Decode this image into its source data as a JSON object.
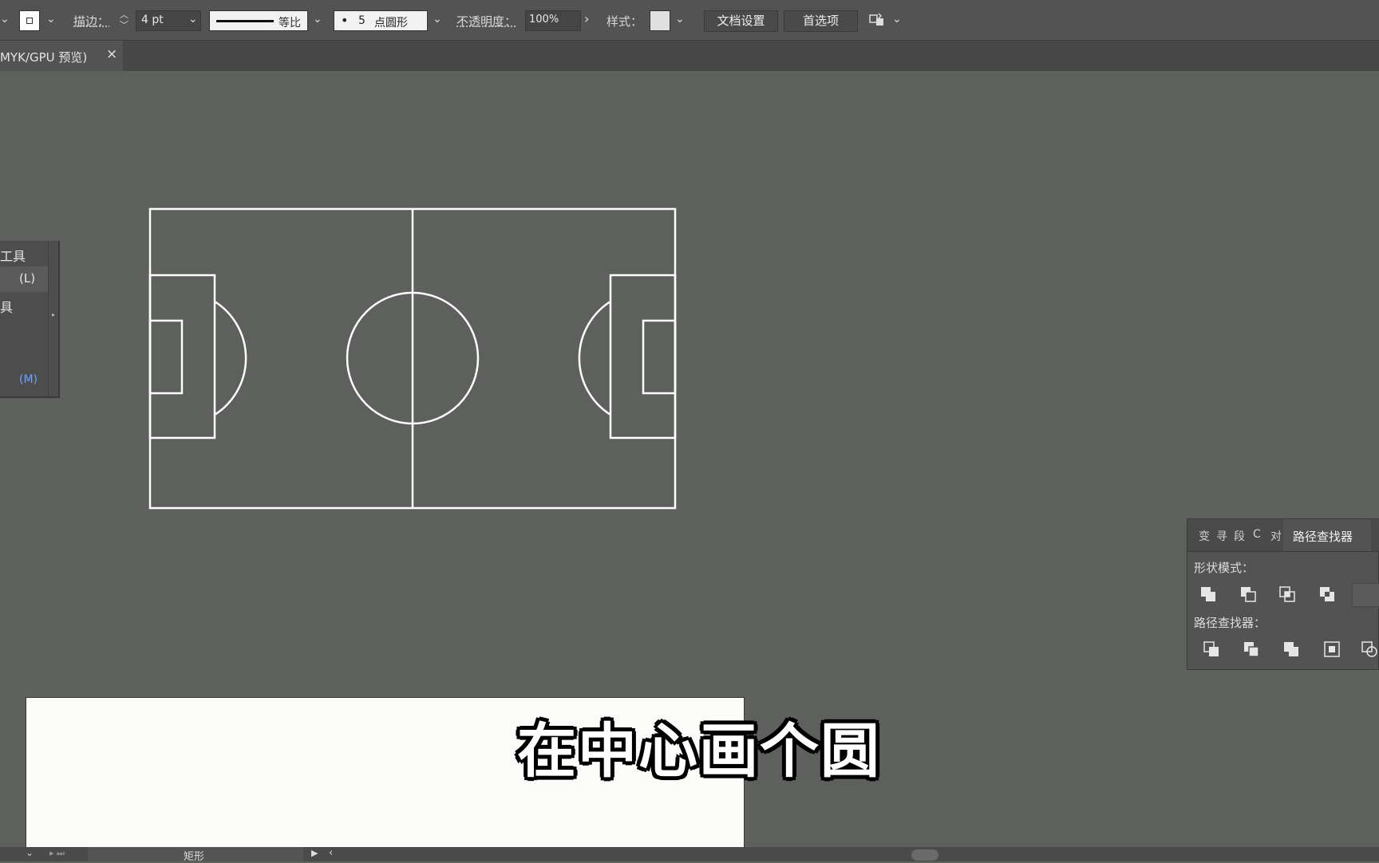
{
  "control_bar": {
    "stroke_label": "描边：",
    "stroke_weight": "4 pt",
    "stroke_profile": "等比",
    "brush_value": "5",
    "brush_label": "点圆形",
    "opacity_label": "不透明度：",
    "opacity_value": "100%",
    "style_label": "样式：",
    "doc_setup_button": "文档设置",
    "preferences_button": "首选项"
  },
  "document_tab": {
    "title": "MYK/GPU 预览)",
    "close": "×"
  },
  "tool_flyout": {
    "items": [
      {
        "label": "工具",
        "shortcut": ""
      },
      {
        "label": "",
        "shortcut": "(L)"
      },
      {
        "label": "具",
        "shortcut": ""
      },
      {
        "label": "",
        "shortcut": "(M)"
      }
    ]
  },
  "pathfinder": {
    "tabs": [
      "变",
      "寻",
      "段",
      "C",
      "对"
    ],
    "active_tab": "路径查找器",
    "shape_modes_label": "形状模式：",
    "pathfinders_label": "路径查找器："
  },
  "subtitle": "在中心画个圆",
  "status_bar": {
    "tool_name": "矩形"
  },
  "colors": {
    "canvas": "#5e605d",
    "panel": "#535353",
    "artwork_stroke": "#ffffff",
    "highlight": "#6aa4ff"
  }
}
